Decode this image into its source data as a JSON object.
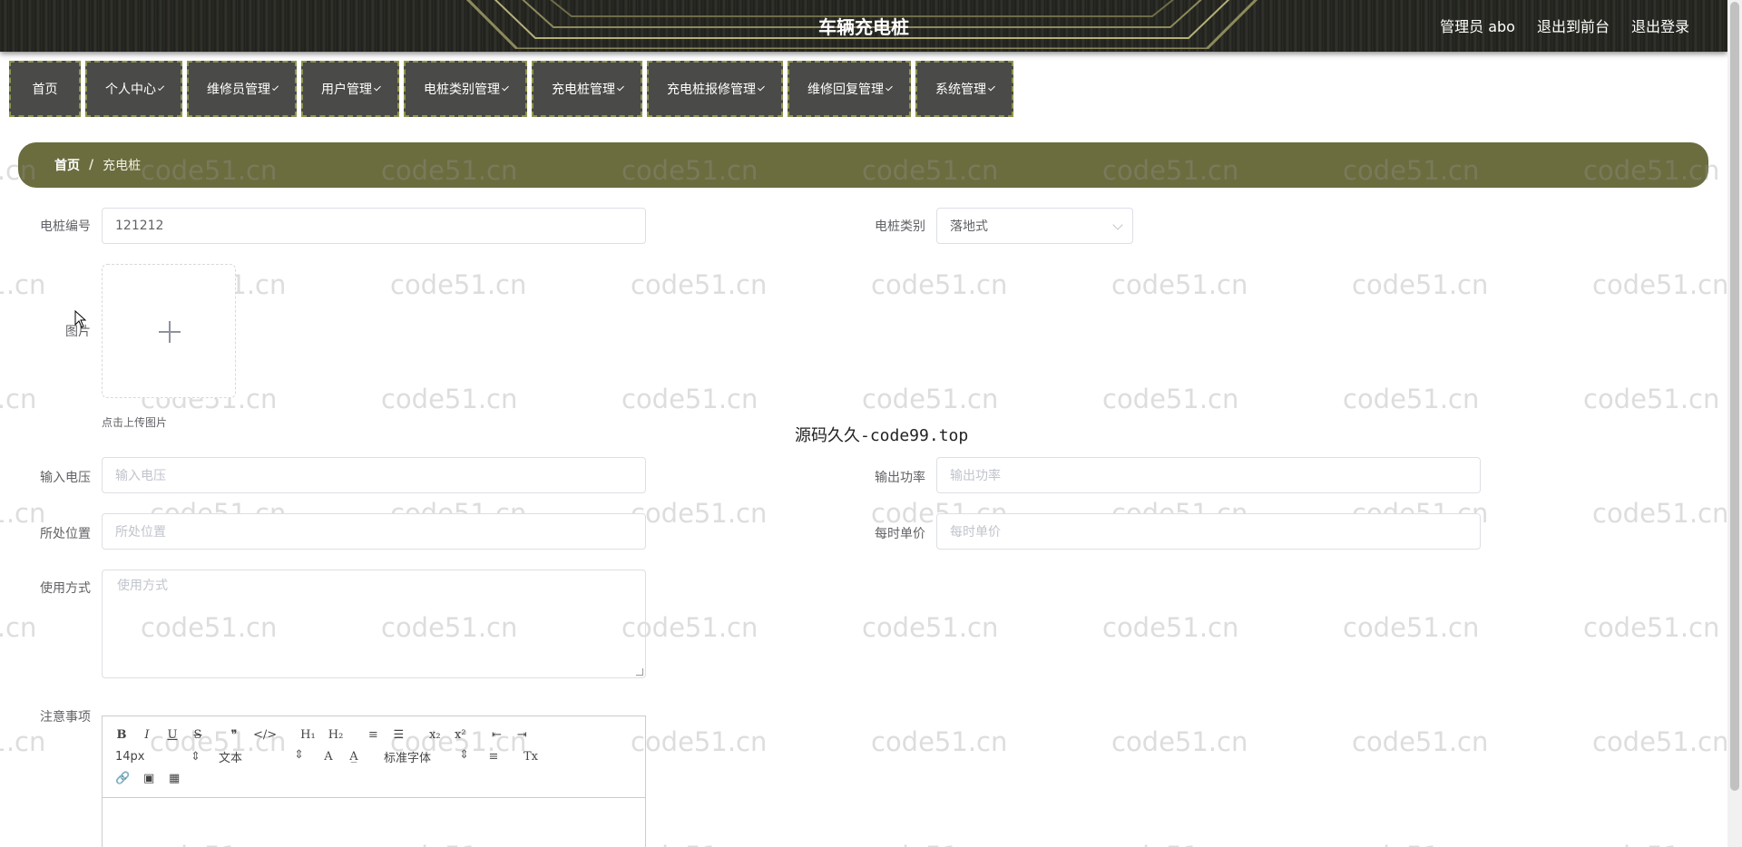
{
  "header": {
    "title": "车辆充电桩",
    "admin": "管理员 abo",
    "to_front": "退出到前台",
    "logout": "退出登录"
  },
  "nav": [
    {
      "label": "首页",
      "dropdown": false
    },
    {
      "label": "个人中心",
      "dropdown": true
    },
    {
      "label": "维修员管理",
      "dropdown": true
    },
    {
      "label": "用户管理",
      "dropdown": true
    },
    {
      "label": "电桩类别管理",
      "dropdown": true
    },
    {
      "label": "充电桩管理",
      "dropdown": true
    },
    {
      "label": "充电桩报修管理",
      "dropdown": true
    },
    {
      "label": "维修回复管理",
      "dropdown": true
    },
    {
      "label": "系统管理",
      "dropdown": true
    }
  ],
  "breadcrumb": {
    "home": "首页",
    "separator": "/",
    "current": "充电桩"
  },
  "form": {
    "pile_no": {
      "label": "电桩编号",
      "value": "121212"
    },
    "pile_type": {
      "label": "电桩类别",
      "value": "落地式"
    },
    "image": {
      "label": "图片",
      "hint": "点击上传图片"
    },
    "input_voltage": {
      "label": "输入电压",
      "placeholder": "输入电压"
    },
    "output_power": {
      "label": "输出功率",
      "placeholder": "输出功率"
    },
    "location": {
      "label": "所处位置",
      "placeholder": "所处位置"
    },
    "unit_price": {
      "label": "每时单价",
      "placeholder": "每时单价"
    },
    "usage": {
      "label": "使用方式",
      "placeholder": "使用方式"
    },
    "notes": {
      "label": "注意事项"
    }
  },
  "editor": {
    "row1": [
      "B",
      "I",
      "U",
      "S",
      "❞",
      "</>",
      "H₁",
      "H₂",
      "≡",
      "☰",
      "x₂",
      "x²",
      "⇤",
      "⇥"
    ],
    "font_size": "14px",
    "block": "文本",
    "font_family": "标准字体",
    "row2_icons": [
      "A",
      "A̲",
      "≡",
      "Tx"
    ],
    "row3": [
      "🔗",
      "▣",
      "▦"
    ]
  },
  "stamp": "源码久久-code99.top",
  "watermark": "code51.cn"
}
